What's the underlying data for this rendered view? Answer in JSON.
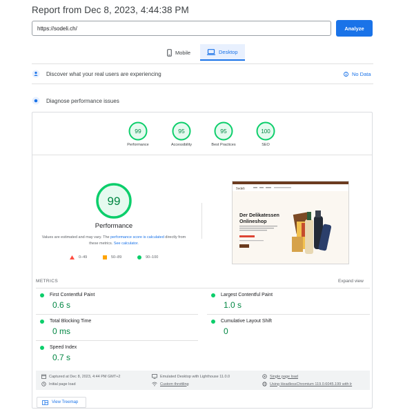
{
  "header": {
    "report_title": "Report from Dec 8, 2023, 4:44:38 PM",
    "url_value": "https://sodeli.ch/",
    "analyze_label": "Analyze"
  },
  "device_tabs": {
    "mobile": "Mobile",
    "desktop": "Desktop",
    "selected": "Desktop"
  },
  "field_data": {
    "title": "Discover what your real users are experiencing",
    "status": "No Data"
  },
  "diagnose": {
    "title": "Diagnose performance issues"
  },
  "scores": [
    {
      "value": 99,
      "label": "Performance"
    },
    {
      "value": 95,
      "label": "Accessibility"
    },
    {
      "value": 95,
      "label": "Best Practices"
    },
    {
      "value": 100,
      "label": "SEO"
    }
  ],
  "performance": {
    "score": 99,
    "label": "Performance",
    "note_prefix": "Values are estimated and may vary. The ",
    "note_link1": "performance score is calculated",
    "note_mid": " directly from these metrics. ",
    "note_link2": "See calculator",
    "note_suffix": "."
  },
  "legend": [
    {
      "range": "0–49",
      "color": "#ff4e42",
      "shape": "triangle"
    },
    {
      "range": "50–89",
      "color": "#ffa400",
      "shape": "square"
    },
    {
      "range": "90–100",
      "color": "#0cce6b",
      "shape": "circle"
    }
  ],
  "site_preview": {
    "logo": "Sodeli",
    "heading_line1": "Der Delikatessen",
    "heading_line2": "Onlineshop"
  },
  "metrics_section": {
    "title": "METRICS",
    "expand_label": "Expand view"
  },
  "metrics": [
    {
      "name": "First Contentful Paint",
      "value": "0.6 s"
    },
    {
      "name": "Largest Contentful Paint",
      "value": "1.0 s"
    },
    {
      "name": "Total Blocking Time",
      "value": "0 ms"
    },
    {
      "name": "Cumulative Layout Shift",
      "value": "0"
    },
    {
      "name": "Speed Index",
      "value": "0.7 s"
    }
  ],
  "run_info": {
    "captured": "Captured at Dec 8, 2023, 4:44 PM GMT+2",
    "emulated": "Emulated Desktop with Lighthouse 11.0.0",
    "single_load": "Single page load",
    "initial_load": "Initial page load",
    "throttling": "Custom throttling",
    "browser": "Using HeadlessChromium 119.0.6045.199 with lr"
  },
  "treemap_label": "View Treemap",
  "colors": {
    "accent": "#1a73e8",
    "pass": "#0cce6b",
    "pass_text": "#018642",
    "pass_bg": "#e5faef"
  }
}
